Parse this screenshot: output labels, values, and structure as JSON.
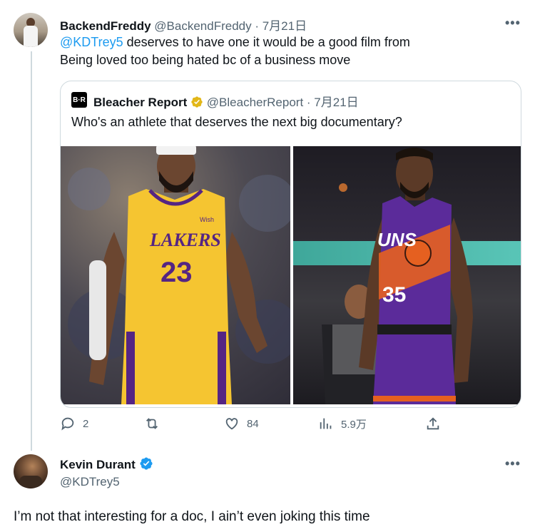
{
  "reply_tweet": {
    "author_name": "BackendFreddy",
    "author_handle": "@BackendFreddy",
    "date": "· 7月21日",
    "mention": "@KDTrey5",
    "text_line1": " deserves to have one it would be a good film from",
    "text_line2": "Being loved too being hated bc of a business move",
    "more": "•••"
  },
  "quoted_tweet": {
    "logo": "B·R",
    "author_name": "Bleacher Report",
    "author_handle": "@BleacherReport",
    "date": "· 7月21日",
    "text": "Who's an athlete that deserves the next big documentary?",
    "images": {
      "left": {
        "jersey_team": "LAKERS",
        "jersey_number": "23",
        "sponsor": "Wish",
        "jersey_color": "#f5c531",
        "accent": "#552583"
      },
      "right": {
        "jersey_team": "UNS",
        "jersey_number": "35",
        "jersey_color": "#5b2b9a",
        "accent": "#e56020"
      }
    }
  },
  "actions": {
    "replies": "2",
    "retweets": "",
    "likes": "84",
    "views": "5.9万"
  },
  "main_tweet": {
    "author_name": "Kevin Durant",
    "author_handle": "@KDTrey5",
    "text": "I’m not that interesting for a doc, I ain’t even joking this time",
    "more": "•••"
  },
  "colors": {
    "link": "#1d9bf0",
    "muted": "#536471",
    "verified_gold": "#e2b719",
    "verified_blue": "#1d9bf0"
  }
}
